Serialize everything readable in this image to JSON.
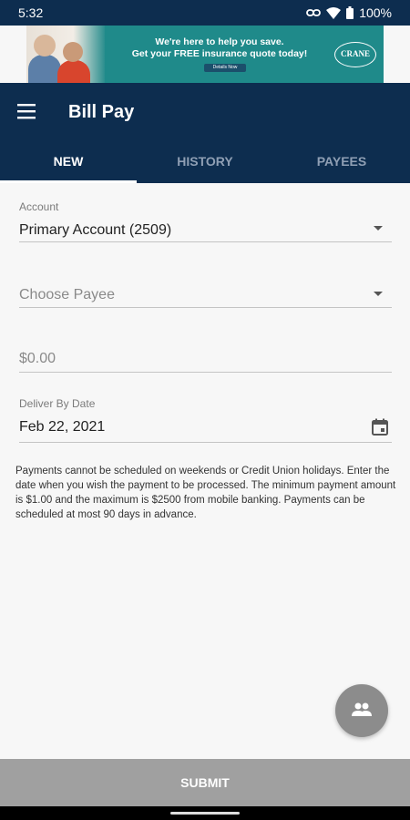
{
  "status_bar": {
    "time": "5:32",
    "battery": "100%"
  },
  "ad": {
    "line1": "We're here to help you save.",
    "line2": "Get your FREE insurance quote today!",
    "cta": "Details Now",
    "logo": "CRANE"
  },
  "app_bar": {
    "title": "Bill Pay"
  },
  "tabs": [
    {
      "label": "NEW",
      "active": true
    },
    {
      "label": "HISTORY",
      "active": false
    },
    {
      "label": "PAYEES",
      "active": false
    }
  ],
  "form": {
    "account": {
      "label": "Account",
      "value": "Primary Account (2509)"
    },
    "payee": {
      "placeholder": "Choose Payee"
    },
    "amount": {
      "placeholder": "$0.00"
    },
    "deliver_by": {
      "label": "Deliver By Date",
      "value": "Feb 22, 2021"
    }
  },
  "info": "Payments cannot be scheduled on weekends or Credit Union holidays. Enter the date when you wish the payment to be processed. The minimum payment amount is $1.00 and the maximum is $2500 from mobile banking. Payments can be scheduled at most 90 days in advance.",
  "submit_label": "SUBMIT",
  "icons": {
    "menu": "menu-icon",
    "dropdown": "chevron-down-icon",
    "calendar": "calendar-icon",
    "fab": "people-icon"
  },
  "colors": {
    "header": "#0d2d4f",
    "submit": "#a0a0a0",
    "fab": "#8c8c8c"
  }
}
